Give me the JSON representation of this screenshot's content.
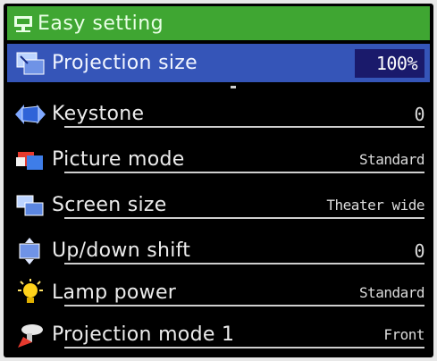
{
  "menu": {
    "title": "Easy setting",
    "items": [
      {
        "label": "Projection size",
        "value": "100%",
        "icon": "projection-size-icon",
        "selected": true
      },
      {
        "label": "Keystone",
        "value": "0",
        "icon": "keystone-icon"
      },
      {
        "label": "Picture mode",
        "value": "Standard",
        "icon": "picture-mode-icon"
      },
      {
        "label": "Screen size",
        "value": "Theater wide",
        "icon": "screen-size-icon"
      },
      {
        "label": "Up/down shift",
        "value": "0",
        "icon": "shift-icon"
      },
      {
        "label": "Lamp power",
        "value": "Standard",
        "icon": "lamp-icon"
      },
      {
        "label": "Projection mode 1",
        "value": "Front",
        "icon": "projection-mode-icon"
      }
    ]
  },
  "colors": {
    "title_bar": "#3fa632",
    "selected_row": "#3555b8",
    "value_box": "#1a1a6b",
    "background": "#000000"
  }
}
